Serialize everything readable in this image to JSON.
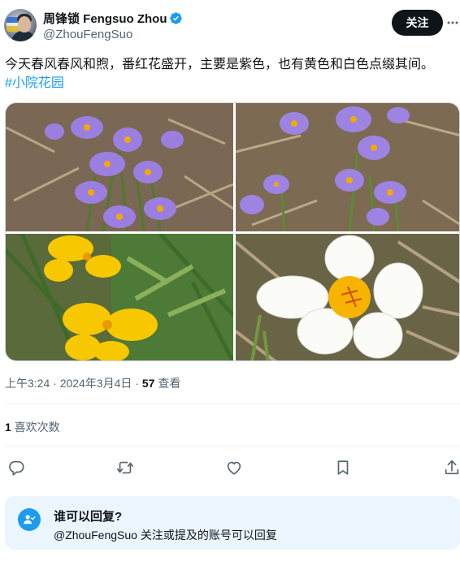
{
  "author": {
    "display_name": "周锋锁 Fengsuo Zhou",
    "handle": "@ZhouFengSuo",
    "verified": true,
    "avatar_icon": "avatar"
  },
  "header": {
    "follow_label": "关注",
    "more_icon": "more-horizontal-icon"
  },
  "tweet": {
    "text": "今天春风春风和煦，番红花盛开，主要是紫色，也有黄色和白色点缀其间。",
    "hashtag": "#小院花园"
  },
  "media": {
    "photos": [
      {
        "subject": "purple crocuses"
      },
      {
        "subject": "purple crocuses"
      },
      {
        "subject": "yellow crocuses"
      },
      {
        "subject": "white crocus"
      }
    ]
  },
  "meta": {
    "time": "上午3:24",
    "separator": " · ",
    "date": "2024年3月4日",
    "views_count": "57",
    "views_label": " 查看"
  },
  "stats": {
    "likes_count": "1",
    "likes_label": " 喜欢次数"
  },
  "actions": [
    {
      "icon": "reply-icon"
    },
    {
      "icon": "retweet-icon"
    },
    {
      "icon": "like-icon"
    },
    {
      "icon": "bookmark-icon"
    },
    {
      "icon": "share-icon"
    }
  ],
  "reply_settings": {
    "title": "谁可以回复?",
    "subtitle": "@ZhouFengSuo 关注或提及的账号可以回复",
    "icon": "person-check-icon"
  },
  "colors": {
    "accent": "#1d9bf0",
    "text": "#0f1419",
    "secondary_text": "#536471",
    "follow_button": "#0f1419",
    "reply_box_bg": "#ebf5fe"
  }
}
